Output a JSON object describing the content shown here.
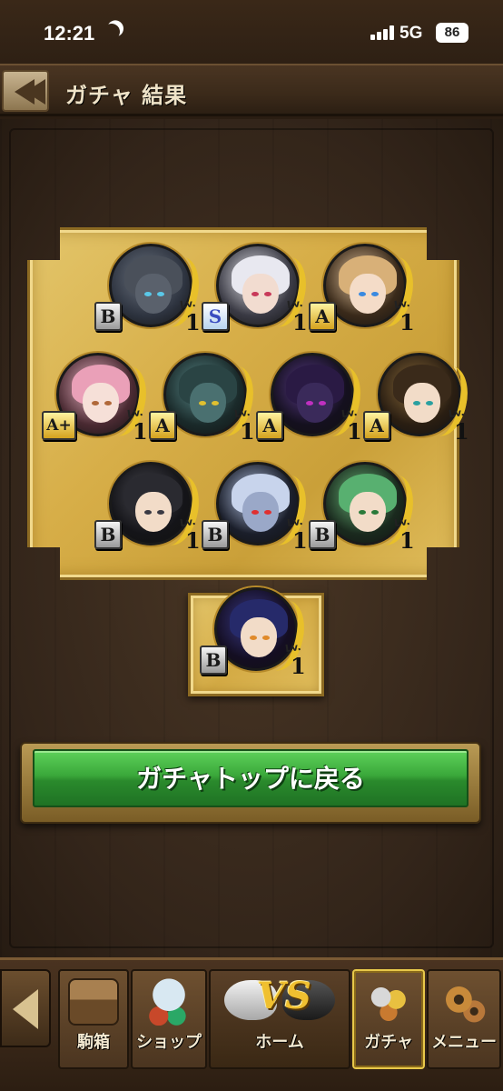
{
  "status_bar": {
    "time": "12:21",
    "network": "5G",
    "battery": "86"
  },
  "header": {
    "title": "ガチャ 結果"
  },
  "results": {
    "lv_label": "Lv.",
    "units": [
      {
        "rank": "B",
        "level": "1",
        "portrait": "gray-cat"
      },
      {
        "rank": "S",
        "level": "1",
        "portrait": "white-haired-girl"
      },
      {
        "rank": "A",
        "level": "1",
        "portrait": "fox-eared-girl"
      },
      {
        "rank": "A+",
        "level": "1",
        "portrait": "pink-haired-girl"
      },
      {
        "rank": "A",
        "level": "1",
        "portrait": "tiger-beast"
      },
      {
        "rank": "A",
        "level": "1",
        "portrait": "purple-demon"
      },
      {
        "rank": "A",
        "level": "1",
        "portrait": "horned-warrior-girl"
      },
      {
        "rank": "B",
        "level": "1",
        "portrait": "black-haired-boy"
      },
      {
        "rank": "B",
        "level": "1",
        "portrait": "silver-dragon"
      },
      {
        "rank": "B",
        "level": "1",
        "portrait": "green-haired-man"
      }
    ],
    "bonus_unit": {
      "rank": "B",
      "level": "1",
      "portrait": "oni-horned-girl"
    }
  },
  "main": {
    "return_button_label": "ガチャトップに戻る"
  },
  "bottom_nav": {
    "items": [
      {
        "label": "駒箱",
        "icon": "chest-icon"
      },
      {
        "label": "ショップ",
        "icon": "shop-icon"
      },
      {
        "label": "ホーム",
        "icon": "vs-icon",
        "badge": "VS"
      },
      {
        "label": "ガチャ",
        "icon": "gacha-icon"
      },
      {
        "label": "メニュー",
        "icon": "gear-icon"
      }
    ]
  }
}
